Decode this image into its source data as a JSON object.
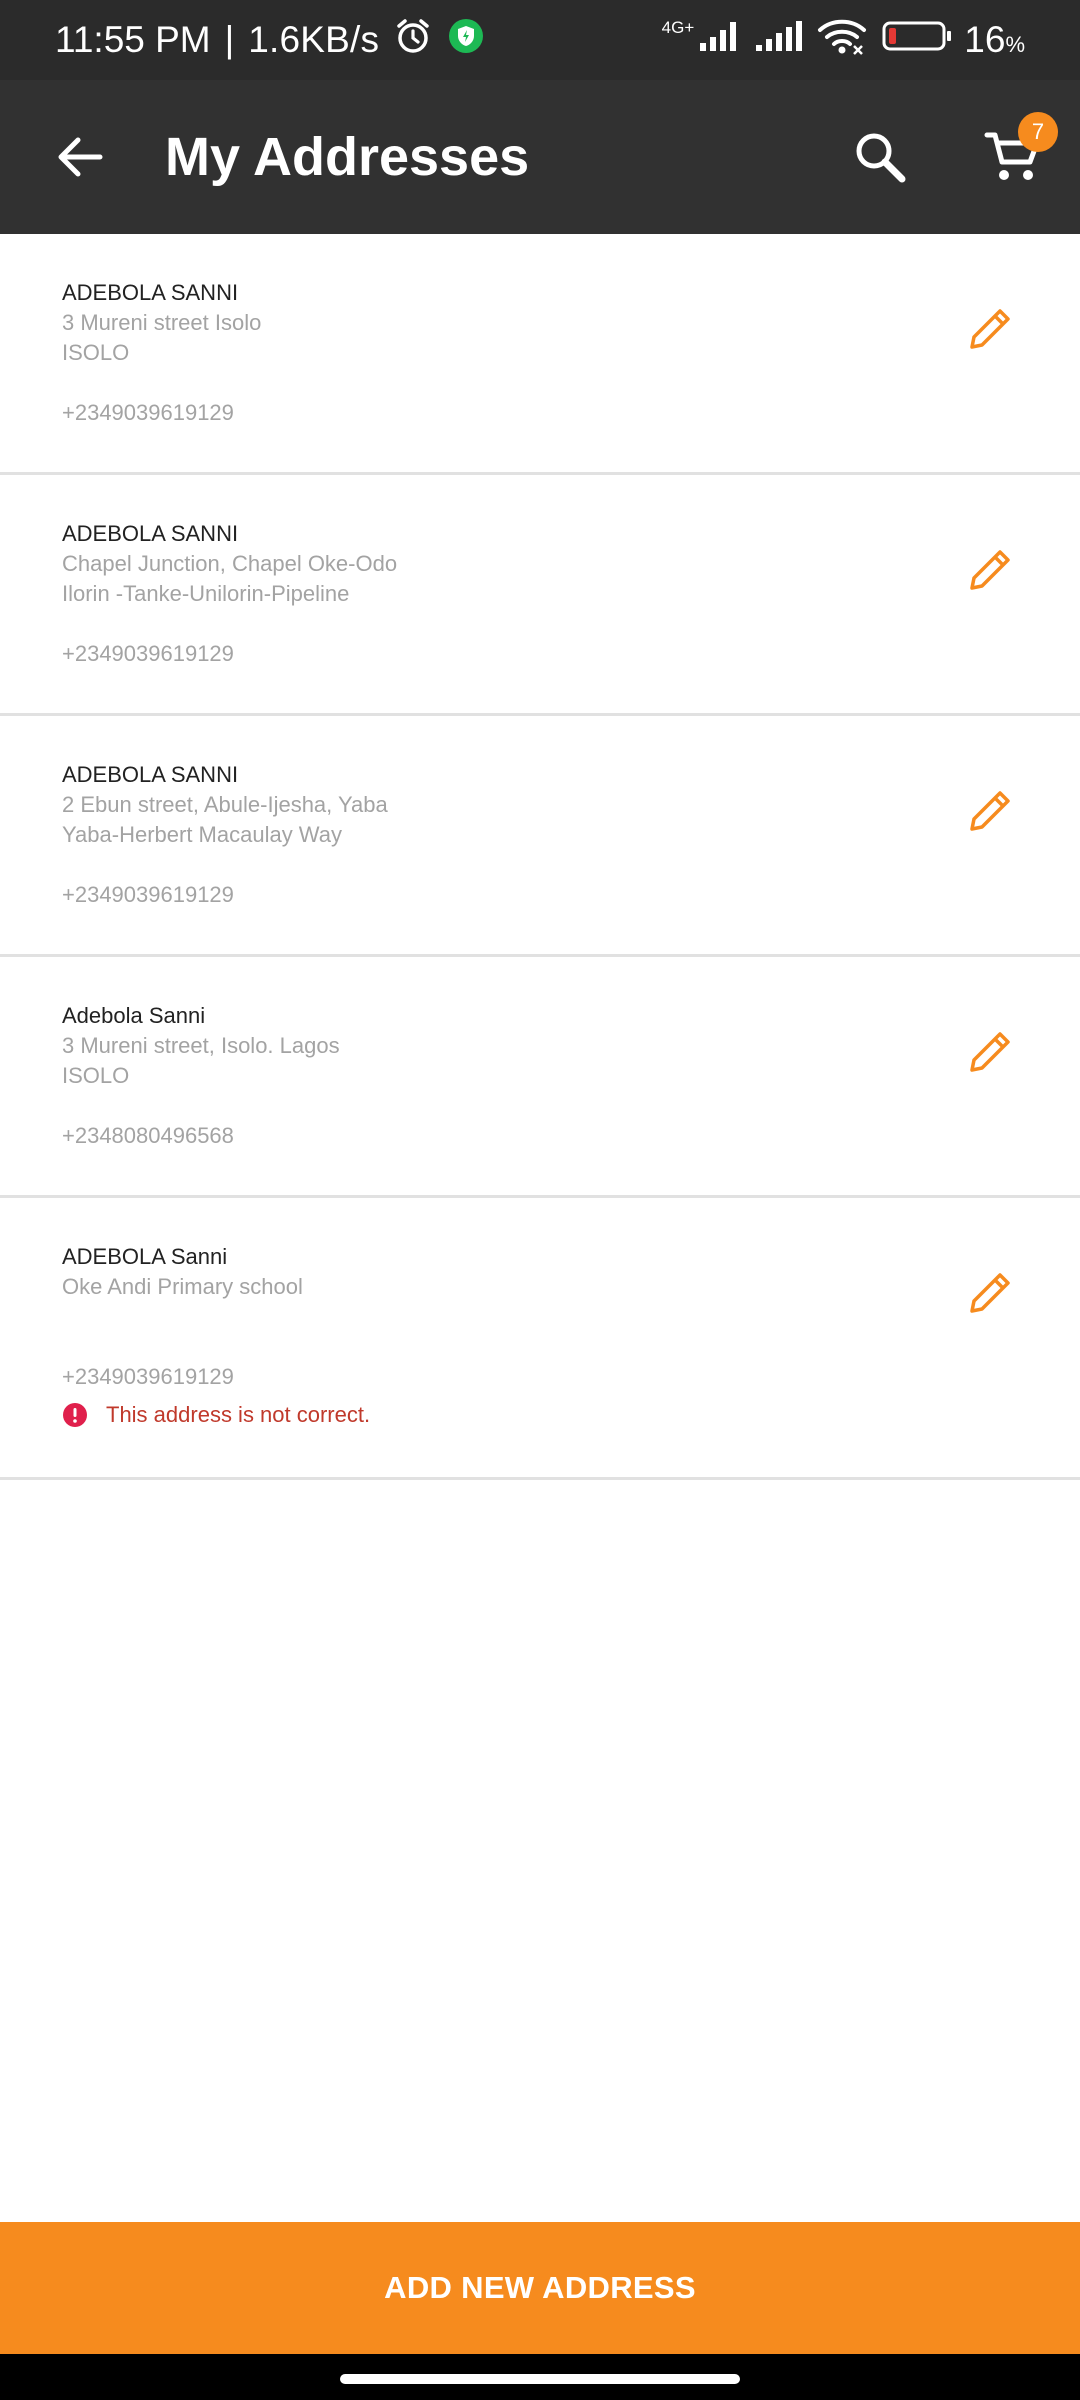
{
  "status_bar": {
    "time": "11:55 PM",
    "separator": "|",
    "speed": "1.6KB/s",
    "network": "4G+",
    "battery_percent": "16",
    "battery_unit": "%"
  },
  "header": {
    "title": "My Addresses",
    "cart_count": "7"
  },
  "addresses": [
    {
      "name": "ADEBOLA SANNI",
      "line1": "3 Mureni street Isolo",
      "line2": "ISOLO",
      "phone": "+2349039619129"
    },
    {
      "name": "ADEBOLA SANNI",
      "line1": "Chapel Junction, Chapel Oke-Odo",
      "line2": "Ilorin -Tanke-Unilorin-Pipeline",
      "phone": "+2349039619129"
    },
    {
      "name": "ADEBOLA SANNI",
      "line1": "2 Ebun street, Abule-Ijesha, Yaba",
      "line2": "Yaba-Herbert Macaulay Way",
      "phone": "+2349039619129"
    },
    {
      "name": "Adebola Sanni",
      "line1": "3 Mureni street, Isolo. Lagos",
      "line2": "ISOLO",
      "phone": "+2348080496568"
    },
    {
      "name": "ADEBOLA Sanni",
      "line1": "Oke Andi Primary school",
      "line2": "",
      "phone": "+2349039619129",
      "error": "This address is not correct."
    }
  ],
  "add_button": {
    "label": "ADD NEW ADDRESS"
  },
  "colors": {
    "accent": "#f68b1e",
    "app_bar": "#313131",
    "error": "#c0392b",
    "error_icon": "#e0204c"
  }
}
